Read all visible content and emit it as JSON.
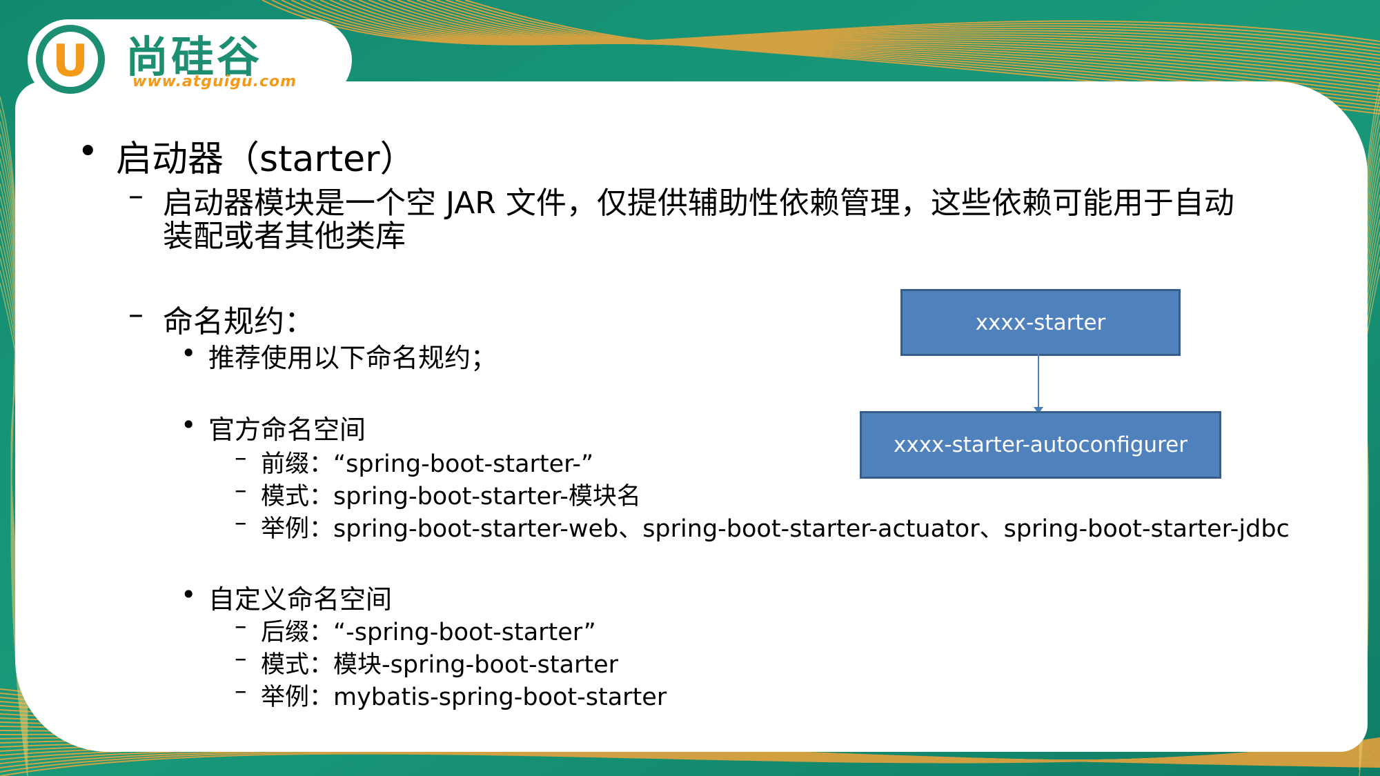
{
  "logo": {
    "letter": "U",
    "name": "尚硅谷",
    "url": "www.atguigu.com"
  },
  "slide": {
    "heading": "启动器（starter）",
    "desc_line1": "启动器模块是一个空 JAR 文件，仅提供辅助性依赖管理，这些依赖可能用于自动",
    "desc_line2": "装配或者其他类库",
    "naming_title": "命名规约：",
    "recommend": "推荐使用以下命名规约；",
    "official": {
      "title": "官方命名空间",
      "prefix": "前缀：“spring-boot-starter-”",
      "pattern": "模式：spring-boot-starter-模块名",
      "example": "举例：spring-boot-starter-web、spring-boot-starter-actuator、spring-boot-starter-jdbc"
    },
    "custom": {
      "title": "自定义命名空间",
      "suffix": "后缀：“-spring-boot-starter”",
      "pattern": "模式：模块-spring-boot-starter",
      "example": "举例：mybatis-spring-boot-starter"
    }
  },
  "diagram": {
    "top_box": "xxxx-starter",
    "bottom_box": "xxxx-starter-autoconfigurer"
  },
  "colors": {
    "background_green": "#1c8f72",
    "accent_orange": "#f39a1b",
    "box_fill": "#4f81bd",
    "box_border": "#385d8a",
    "arrow": "#4a7ebb"
  }
}
